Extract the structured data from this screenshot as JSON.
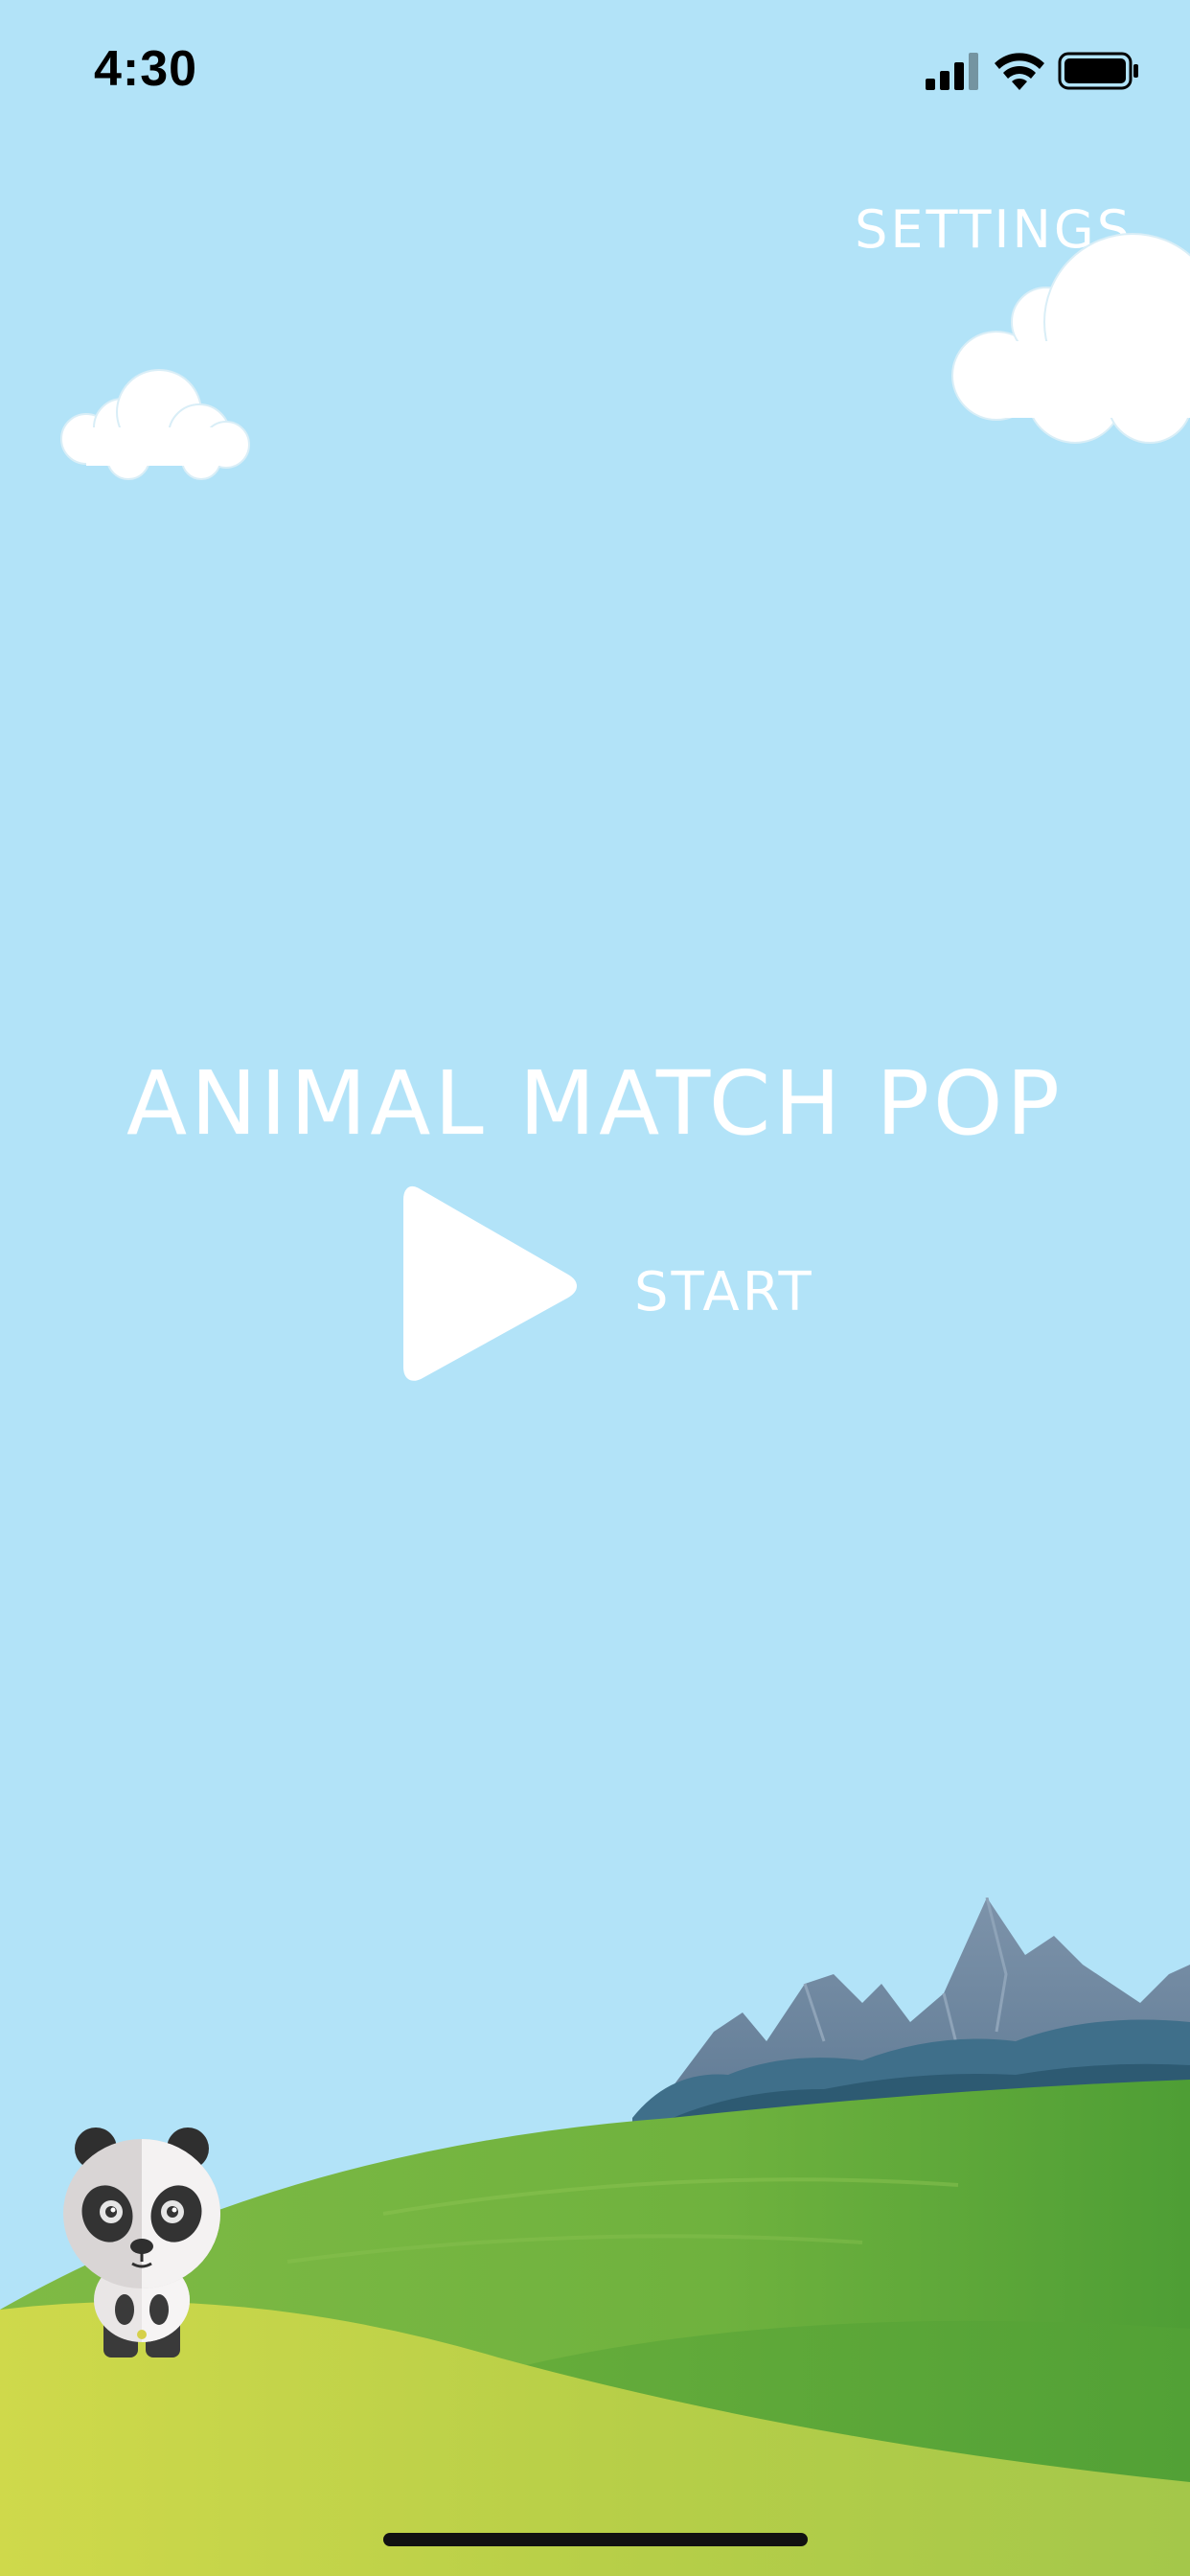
{
  "status_bar": {
    "time": "4:30",
    "icons": [
      "cellular-signal-icon",
      "wifi-icon",
      "battery-icon"
    ]
  },
  "settings": {
    "label": "SETTINGS"
  },
  "title": "ANIMAL MATCH POP",
  "start": {
    "label": "START",
    "icon": "play-icon"
  },
  "decor": {
    "clouds": [
      "cloud-small",
      "cloud-large"
    ],
    "mascot": "panda",
    "scenery": [
      "mountains",
      "green-hills"
    ]
  },
  "colors": {
    "sky": "#b2e3f8",
    "text": "#ffffff",
    "grass_light": "#c8d64a",
    "grass_dark": "#5aa436",
    "mountain": "#6f8aa3"
  }
}
